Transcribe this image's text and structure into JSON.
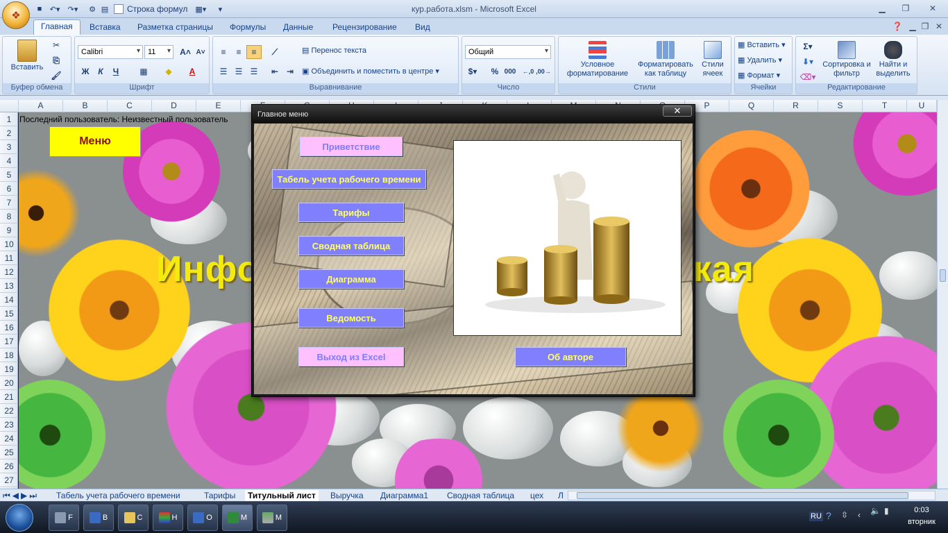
{
  "window": {
    "title": "кур.работа.xlsm - Microsoft Excel"
  },
  "qat": {
    "formula_bar_label": "Строка формул"
  },
  "ribbon_tabs": [
    "Главная",
    "Вставка",
    "Разметка страницы",
    "Формулы",
    "Данные",
    "Рецензирование",
    "Вид"
  ],
  "ribbon": {
    "clipboard": {
      "paste": "Вставить",
      "label": "Буфер обмена"
    },
    "font": {
      "name": "Calibri",
      "size": "11",
      "label": "Шрифт"
    },
    "alignment": {
      "wrap": "Перенос текста",
      "merge": "Объединить и поместить в центре",
      "label": "Выравнивание"
    },
    "number": {
      "format": "Общий",
      "label": "Число",
      "percent": "%",
      "thousands": "000"
    },
    "styles": {
      "conditional": "Условное форматирование",
      "table": "Форматировать как таблицу",
      "cell_styles": "Стили ячеек",
      "label": "Стили"
    },
    "cells": {
      "insert": "Вставить",
      "delete": "Удалить",
      "format": "Формат",
      "label": "Ячейки"
    },
    "editing": {
      "sort": "Сортировка и фильтр",
      "find": "Найти и выделить",
      "label": "Редактирование"
    }
  },
  "columns": [
    "A",
    "B",
    "C",
    "D",
    "E",
    "F",
    "G",
    "H",
    "I",
    "J",
    "K",
    "L",
    "M",
    "N",
    "O",
    "P",
    "Q",
    "R",
    "S",
    "T",
    "U"
  ],
  "rows": [
    "1",
    "2",
    "3",
    "4",
    "5",
    "6",
    "7",
    "8",
    "9",
    "10",
    "11",
    "12",
    "13",
    "14",
    "15",
    "16",
    "17",
    "18",
    "19",
    "20",
    "21",
    "22",
    "23",
    "24",
    "25",
    "26",
    "27"
  ],
  "sheet": {
    "user_line": "Последний пользователь: Неизвестный пользователь",
    "menu_button": "Меню",
    "big_title": "Информационно-аналитическая"
  },
  "dialog": {
    "title": "Главное меню",
    "close": "✕",
    "buttons": {
      "greeting": "Приветствие",
      "timesheet": "Табель учета рабочего времени",
      "tariffs": "Тарифы",
      "pivot": "Сводная таблица",
      "chart": "Диаграмма",
      "statement": "Ведомость",
      "exit": "Выход из Excel",
      "about": "Об авторе"
    }
  },
  "sheet_tabs": [
    "Табель учета рабочего времени",
    "Тарифы",
    "Титульный лист",
    "Выручка",
    "Диаграмма1",
    "Сводная таблица",
    "цех",
    "Л"
  ],
  "active_sheet": "Титульный лист",
  "taskbar": {
    "items": [
      "F",
      "В",
      "С",
      "Н",
      "О",
      "М",
      "М"
    ],
    "lang": "RU",
    "time": "0:03",
    "day": "вторник"
  }
}
